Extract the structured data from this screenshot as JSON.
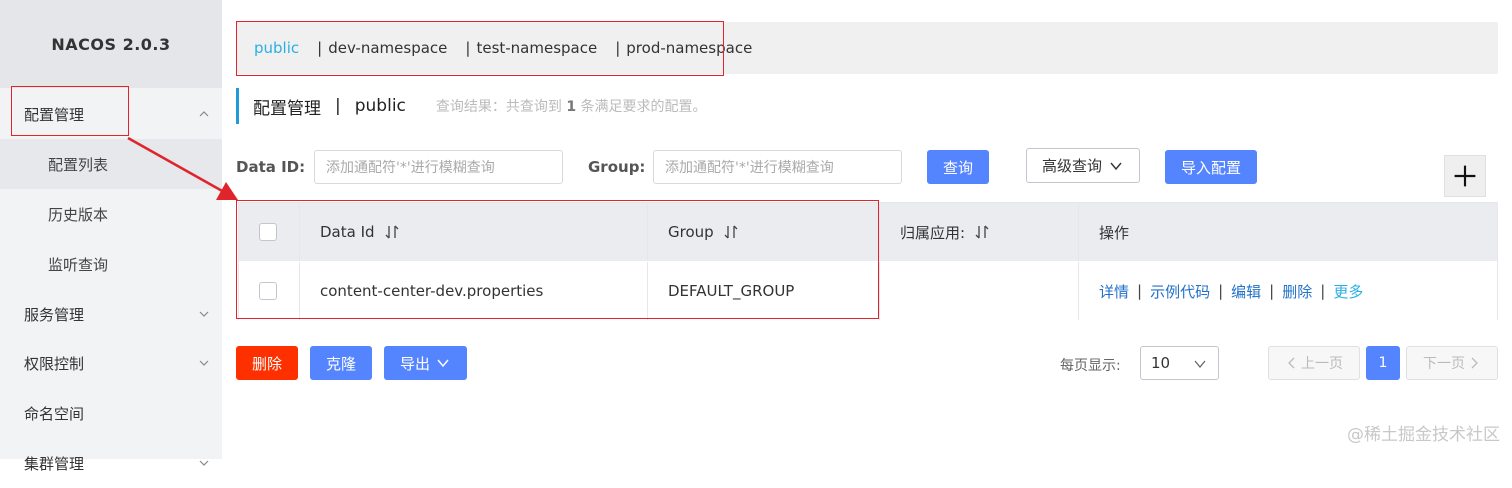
{
  "app": {
    "logo": "NACOS 2.0.3"
  },
  "sidebar": {
    "groups": [
      {
        "label": "配置管理",
        "children": [
          "配置列表",
          "历史版本",
          "监听查询"
        ]
      },
      {
        "label": "服务管理"
      },
      {
        "label": "权限控制"
      },
      {
        "label": "命名空间"
      },
      {
        "label": "集群管理"
      }
    ]
  },
  "namespaces": [
    {
      "label": "public",
      "active": true
    },
    {
      "label": "dev-namespace"
    },
    {
      "label": "test-namespace"
    },
    {
      "label": "prod-namespace"
    }
  ],
  "namespace_separator": "|",
  "page": {
    "title": "配置管理",
    "title_sep": "|",
    "namespace": "public",
    "result_prefix": "查询结果：共查询到",
    "result_count": "1",
    "result_suffix": "条满足要求的配置。"
  },
  "search": {
    "data_id_label": "Data ID:",
    "data_id_placeholder": "添加通配符'*'进行模糊查询",
    "group_label": "Group:",
    "group_placeholder": "添加通配符'*'进行模糊查询",
    "query_button": "查询",
    "advanced_button": "高级查询",
    "import_button": "导入配置"
  },
  "table": {
    "headers": [
      "Data Id",
      "Group",
      "归属应用:",
      "操作"
    ],
    "rows": [
      {
        "data_id": "content-center-dev.properties",
        "group": "DEFAULT_GROUP",
        "app": "",
        "actions": [
          "详情",
          "示例代码",
          "编辑",
          "删除",
          "更多"
        ]
      }
    ]
  },
  "bulk_actions": {
    "delete": "删除",
    "clone": "克隆",
    "export": "导出"
  },
  "pagination": {
    "per_page_label": "每页显示:",
    "per_page_value": "10",
    "prev": "上一页",
    "current": "1",
    "next": "下一页"
  },
  "watermark": "@稀土掘金技术社区",
  "colors": {
    "accent": "#2baee6",
    "primary_button": "#5584ff",
    "danger_button": "#ff3000",
    "annotation": "#e0242b"
  }
}
